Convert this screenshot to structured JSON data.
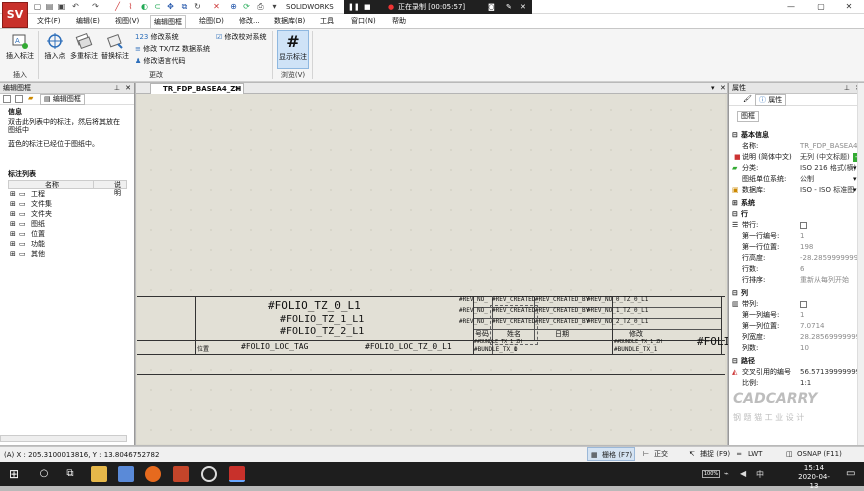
{
  "app": {
    "logo": "SV",
    "name": "SOLIDWORKS"
  },
  "recording": {
    "label": "正在录制 [00:05:57]"
  },
  "menu": [
    "文件(F)",
    "编辑(E)",
    "视图(V)",
    "编辑图框",
    "绘图(D)",
    "修改...",
    "数据库(B)",
    "工具",
    "窗口(N)",
    "帮助"
  ],
  "ribbon": {
    "insert_tag": "插入标注",
    "insert_point": "插入点",
    "multi_tag": "多重标注",
    "replace_tag": "替换标注",
    "modify_system": "修改系统",
    "modify_tx": "修改 TX/TZ 数据系统",
    "modify_lang": "修改语言代码",
    "modify_check": "修改校对系统",
    "show_tag": "显示标注",
    "group_insert": "插入",
    "group_modify": "更改",
    "group_browse": "浏览(V)"
  },
  "left_panel": {
    "title": "编辑图框",
    "tab": "编辑图框",
    "info_title": "信息",
    "info_text": "双击此列表中的标注，然后将其放在图纸中",
    "info_note": "蓝色的标注已经位于图纸中。",
    "list_title": "标注列表",
    "col_name": "名称",
    "col_desc": "说明",
    "items": [
      "工程",
      "文件集",
      "文件夹",
      "图纸",
      "位置",
      "功能",
      "其他"
    ]
  },
  "document": {
    "tab": "TR_FDP_BASEA4_ZH"
  },
  "titleblock": {
    "folio0": "#FOLIO_TZ_0_L1",
    "folio1": "#FOLIO_TZ_1_L1",
    "folio2": "#FOLIO_TZ_2_L1",
    "loc_label": "位置",
    "loc_tag": "#FOLIO_LOC_TAG",
    "loc_tz": "#FOLIO_LOC_TZ_0_L1",
    "rev_no": "#REV_NO_",
    "rev_created": "#REV_CREATED_",
    "rev_created_by": "#REV_CREATED_BY",
    "rev_no_tz0": "#REV_NO_0_TZ_0_L1",
    "rev_no_tz1": "#REV_NO_1_TZ_0_L1",
    "rev_no_tz2": "#REV_NO_2_TZ_0_L1",
    "h_no": "号码",
    "h_name": "姓名",
    "h_date": "日期",
    "h_modify": "修改",
    "bundle_tx_zh": "##BUNDLE_TX_1_ZH",
    "bundle_tx": "#BUNDLE_TX_1",
    "bundle_tx_zh2": "##BUNDLE_TX_1_ZH",
    "bundle_tx2": "#BUNDLE_TX_1",
    "zero": "0",
    "right_edge": "#FOLI"
  },
  "properties": {
    "title": "属性",
    "tab": "属性",
    "subtab": "图框",
    "sec_basic": "基本信息",
    "name_k": "名称:",
    "name_v": "TR_FDP_BASEA4_ZH",
    "desc_k": "说明 (简体中文)",
    "desc_v": "无列 (中文标题)",
    "cat_k": "分类:",
    "cat_v": "ISO 216 格式(横)",
    "unit_k": "图纸单位系统:",
    "unit_v": "公制",
    "db_k": "数据库:",
    "db_v": "ISO - ISO 标准图",
    "sec_system": "系统",
    "sec_row": "行",
    "row_has_k": "带行:",
    "row_first_no_k": "第一行编号:",
    "row_first_no_v": "1",
    "row_first_pos_k": "第一行位置:",
    "row_first_pos_v": "198",
    "row_height_k": "行高度:",
    "row_height_v": "-28.285999999999",
    "row_count_k": "行数:",
    "row_count_v": "6",
    "row_order_k": "行排序:",
    "row_order_v": "重新从每列开始",
    "sec_col": "列",
    "col_has_k": "带列:",
    "col_first_no_k": "第一列编号:",
    "col_first_no_v": "1",
    "col_first_pos_k": "第一列位置:",
    "col_first_pos_v": "7.0714",
    "col_width_k": "列宽度:",
    "col_width_v": "28.2856999999999",
    "col_count_k": "列数:",
    "col_count_v": "10",
    "sec_path": "路径",
    "xref_k": "交叉引用的编号",
    "xref_v": "56.5713999999999",
    "scale_k": "比例:",
    "scale_v": "1:1"
  },
  "watermark": {
    "brand": "CADCARRY",
    "sub": "钢  题  猫  工  业  设  计"
  },
  "status": {
    "coords": "(A) X : 205.3100013816, Y : 13.8046752782",
    "grid": "栅格 (F7)",
    "ortho": "正交 (F8)",
    "snap": "捕捉 (F9)",
    "lwt": "LWT (F10)",
    "osnap": "OSNAP (F11)"
  },
  "taskbar": {
    "time": "15:14",
    "date": "2020-04-13",
    "battery": "100%"
  },
  "colors": {
    "accent": "#2e6fba",
    "logo": "#c8312b",
    "taskbar": "#1e1e1e"
  }
}
